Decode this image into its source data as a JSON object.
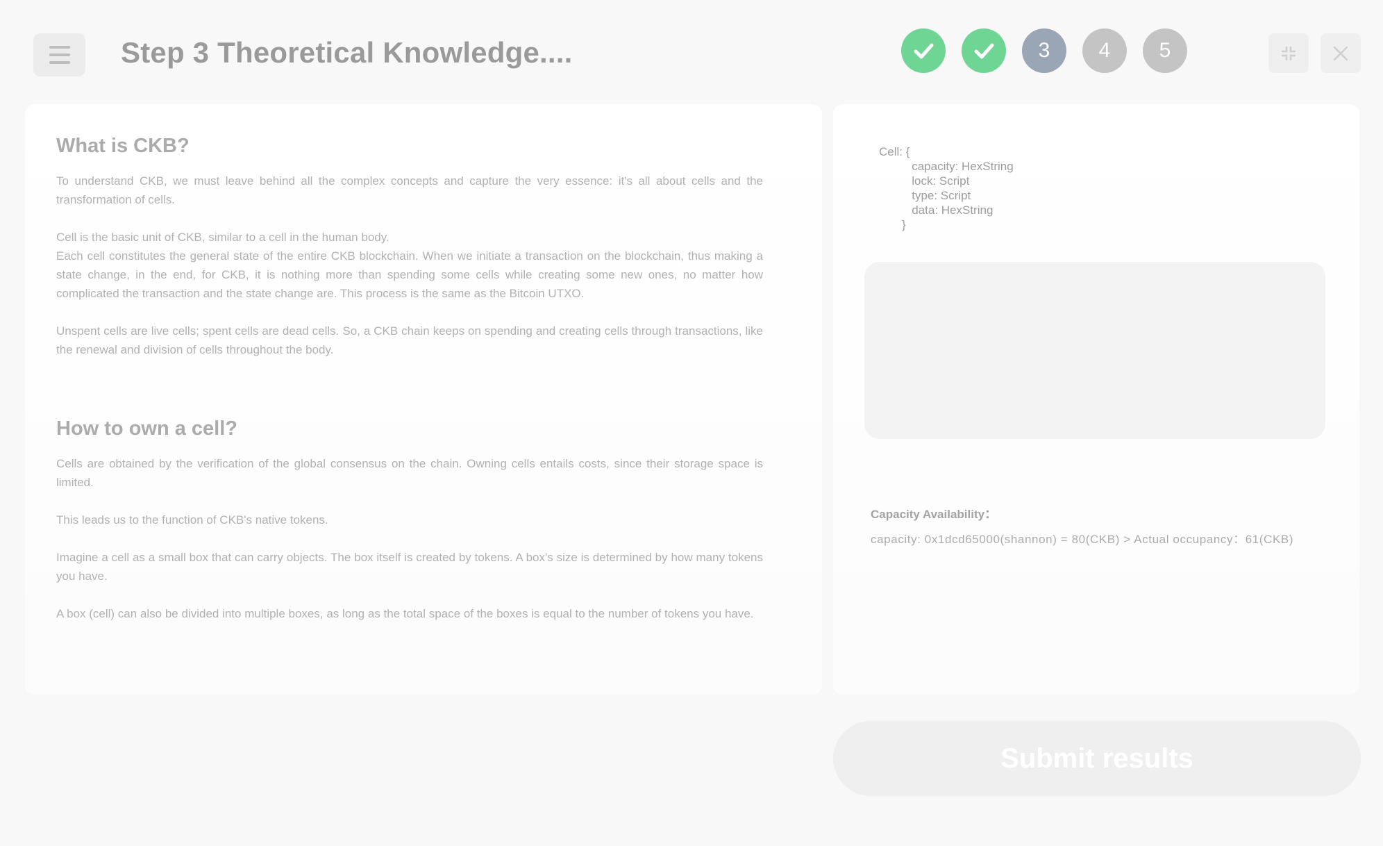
{
  "header": {
    "title": "Step 3 Theoretical Knowledge....",
    "steps": [
      {
        "label": "",
        "state": "done"
      },
      {
        "label": "",
        "state": "done"
      },
      {
        "label": "3",
        "state": "current"
      },
      {
        "label": "4",
        "state": "todo"
      },
      {
        "label": "5",
        "state": "todo"
      }
    ]
  },
  "left": {
    "section1_title": "What is CKB?",
    "p1": "To understand CKB, we must leave behind all the complex concepts and capture the very essence: it's all about cells and the transformation of cells.",
    "p2a": "Cell is the basic unit of CKB, similar to a cell in the human body.",
    "p2b": "Each cell constitutes the general state of the entire CKB blockchain. When we initiate a transaction on the blockchain, thus making a state change, in the end, for CKB, it is nothing more than spending some cells while creating some new ones, no matter how complicated the transaction and the state change are. This process is the same as the Bitcoin UTXO.",
    "p3": "Unspent cells are live cells; spent cells are dead cells. So, a CKB chain keeps on spending and creating cells through transactions, like the renewal and division of cells throughout the body.",
    "section2_title": "How to own a cell?",
    "p4": "Cells are obtained by the verification of the global consensus on the chain. Owning cells entails costs, since their storage space is limited.",
    "p5": "This leads us to the function of CKB's native tokens.",
    "p6": "Imagine a cell as a small box that can carry objects. The box itself is created by tokens. A box's size is determined by how many tokens you have.",
    "p7": "A box (cell) can also be divided into multiple boxes, as long as the total space of the boxes is equal to the number of tokens you have."
  },
  "right": {
    "code": "Cell: {\n          capacity: HexString\n          lock: Script\n          type: Script\n          data: HexString\n       }",
    "capacity_title": "Capacity Availability：",
    "capacity_line": "capacity: 0x1dcd65000(shannon) = 80(CKB) > Actual occupancy：61(CKB)"
  },
  "submit_label": "Submit results",
  "colors": {
    "done": "#6fd594",
    "current": "#9aa5b6",
    "todo": "#c4c4c4"
  }
}
